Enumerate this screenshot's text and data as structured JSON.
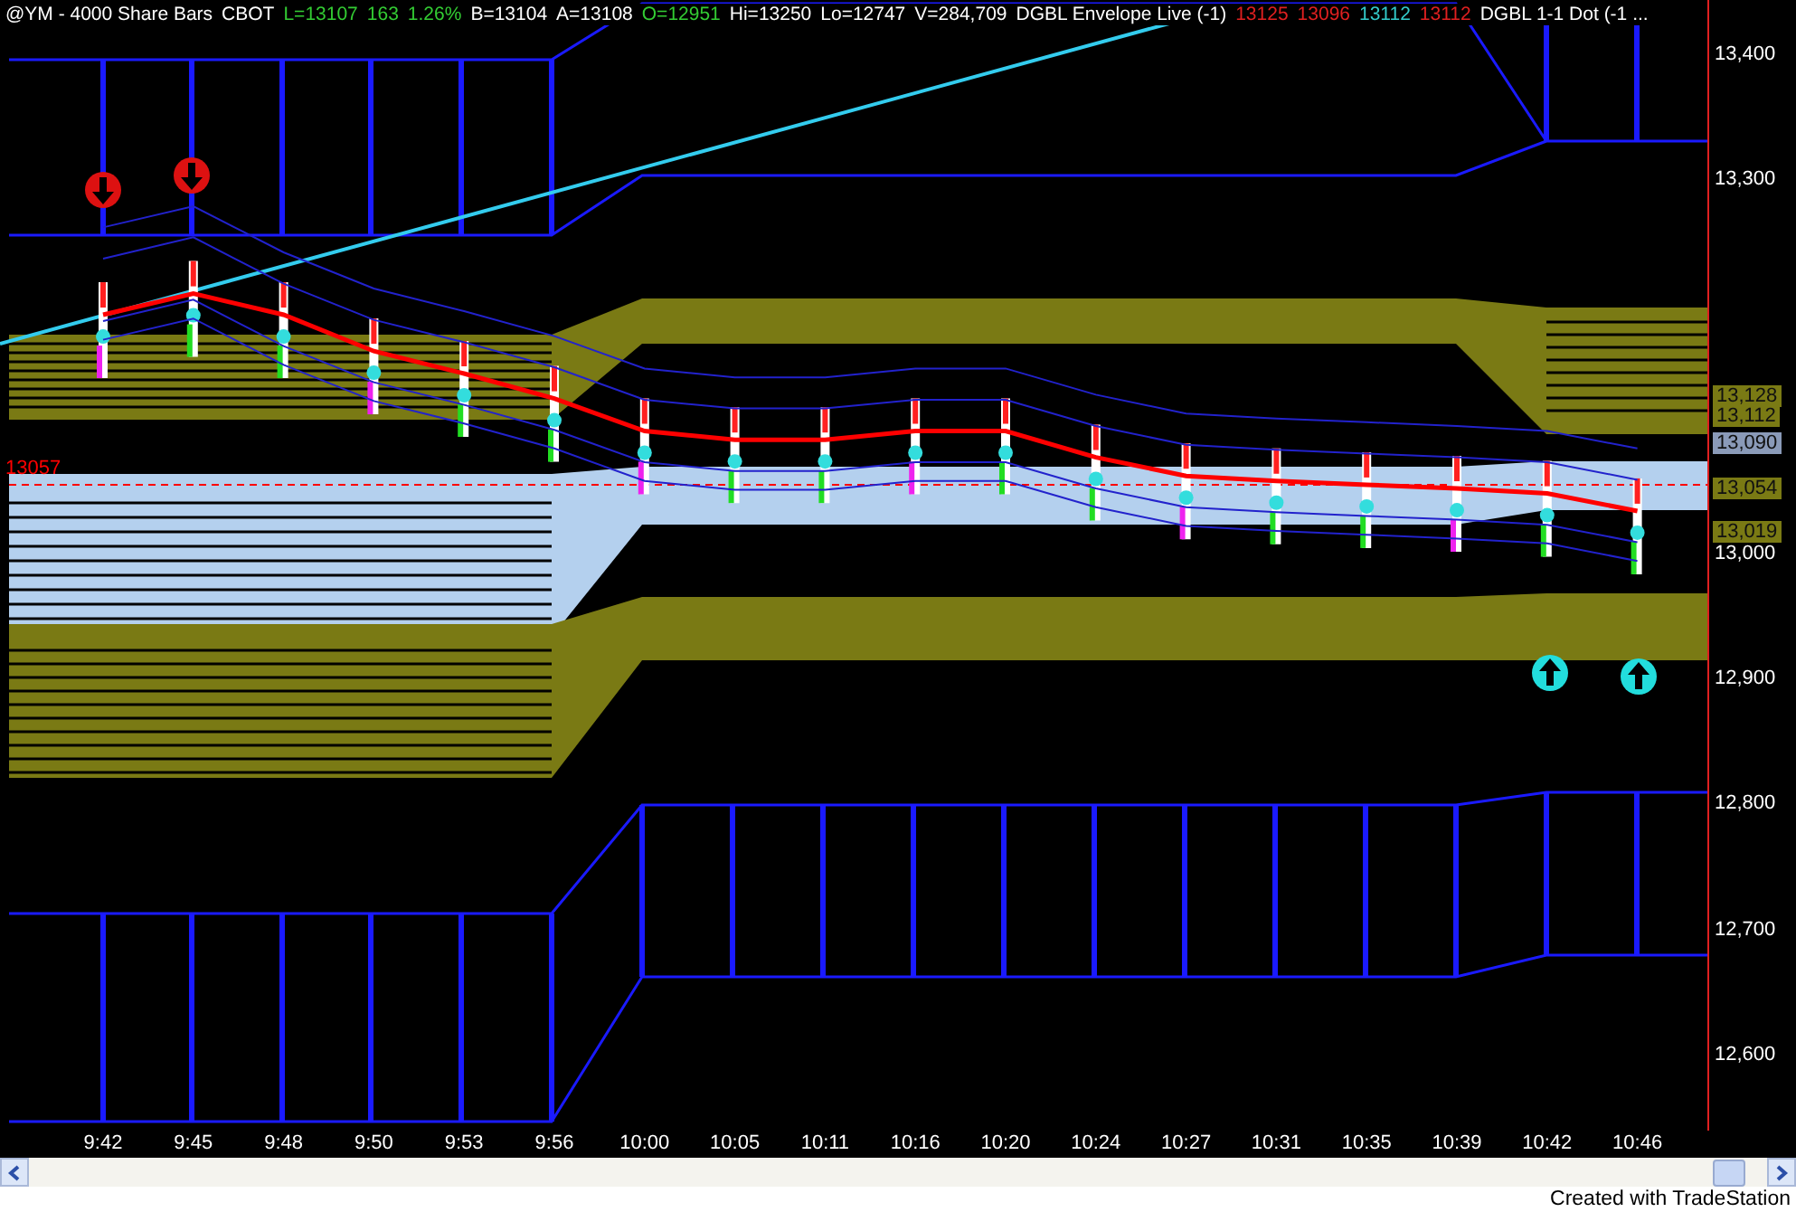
{
  "header": [
    {
      "text": "@YM - 4000 Share Bars",
      "color": "#ffffff"
    },
    {
      "text": "CBOT",
      "color": "#ffffff"
    },
    {
      "text": "L=13107",
      "color": "#33cc33"
    },
    {
      "text": "163",
      "color": "#33cc33"
    },
    {
      "text": "1.26%",
      "color": "#33cc33"
    },
    {
      "text": "B=13104",
      "color": "#ffffff"
    },
    {
      "text": "A=13108",
      "color": "#ffffff"
    },
    {
      "text": "O=12951",
      "color": "#33cc33"
    },
    {
      "text": "Hi=13250",
      "color": "#ffffff"
    },
    {
      "text": "Lo=12747",
      "color": "#ffffff"
    },
    {
      "text": "V=284,709",
      "color": "#ffffff"
    },
    {
      "text": "DGBL Envelope Live (-1)",
      "color": "#ffffff"
    },
    {
      "text": "13125",
      "color": "#e02020"
    },
    {
      "text": "13096",
      "color": "#e02020"
    },
    {
      "text": "13112",
      "color": "#33cccc"
    },
    {
      "text": "13112",
      "color": "#e02020"
    },
    {
      "text": "DGBL 1-1 Dot (-1 ...",
      "color": "#ffffff"
    }
  ],
  "chart": {
    "chart_data": {
      "type": "line",
      "categories": [
        "9:42",
        "9:45",
        "9:48",
        "9:50",
        "9:53",
        "9:56",
        "10:00",
        "10:05",
        "10:11",
        "10:16",
        "10:20",
        "10:24",
        "10:27",
        "10:31",
        "10:35",
        "10:39",
        "10:42",
        "10:46"
      ],
      "series": [
        {
          "color": "#ff0000",
          "values": [
            13193,
            13210,
            13193,
            13164,
            13146,
            13126,
            13100,
            13093,
            13093,
            13100,
            13100,
            13079,
            13064,
            13060,
            13057,
            13054,
            13050,
            13036
          ]
        },
        {
          "color": "#2222cc",
          "values": [
            13173,
            13190,
            13153,
            13124,
            13106,
            13086,
            13060,
            13053,
            13053,
            13060,
            13060,
            13039,
            13024,
            13020,
            13017,
            13014,
            13010,
            12996
          ]
        },
        {
          "color": "#2222cc",
          "values": [
            13188,
            13205,
            13168,
            13139,
            13121,
            13101,
            13075,
            13068,
            13068,
            13075,
            13075,
            13054,
            13039,
            13035,
            13032,
            13029,
            13025,
            13011
          ]
        },
        {
          "color": "#2222cc",
          "values": [
            13238,
            13255,
            13218,
            13189,
            13171,
            13151,
            13125,
            13118,
            13118,
            13125,
            13125,
            13104,
            13089,
            13085,
            13082,
            13079,
            13075,
            13061
          ]
        },
        {
          "color": "#2222cc",
          "values": [
            13263,
            13280,
            13243,
            13214,
            13196,
            13176,
            13150,
            13143,
            13143,
            13150,
            13150,
            13129,
            13114,
            13110,
            13107,
            13104,
            13100,
            13086
          ]
        }
      ],
      "ylim": [
        12540,
        13445
      ],
      "yticks": [
        {
          "value": 12600,
          "label": "12,600"
        },
        {
          "value": 12700,
          "label": "12,700"
        },
        {
          "value": 12800,
          "label": "12,800"
        },
        {
          "value": 12900,
          "label": "12,900"
        },
        {
          "value": 13000,
          "label": "13,000"
        },
        {
          "value": 13300,
          "label": "13,300"
        },
        {
          "value": 13400,
          "label": "13,400"
        }
      ]
    },
    "price_line": {
      "label": "13057",
      "color": "#ff0000"
    },
    "axis_markers": [
      {
        "label": "13,128",
        "color": "#7a7a14"
      },
      {
        "label": "13,112",
        "color": "#7a7a14"
      },
      {
        "label": "13,090",
        "color": "#8a9ab8"
      },
      {
        "label": "13,054",
        "color": "#7a7a14"
      },
      {
        "label": "13,019",
        "color": "#7a7a14"
      }
    ]
  },
  "footer": "Created with TradeStation"
}
